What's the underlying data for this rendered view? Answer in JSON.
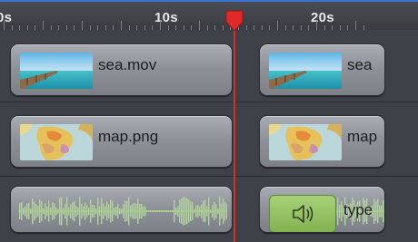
{
  "ruler": {
    "labels": [
      "0s",
      "10s",
      "20s"
    ]
  },
  "tracks": {
    "video": {
      "clip1_label": "sea.mov",
      "clip2_label": "sea"
    },
    "image": {
      "clip1_label": "map.png",
      "clip2_label": "map"
    },
    "audio": {
      "clip2_label": "type"
    }
  },
  "colors": {
    "accent": "#3b6fd0",
    "playhead": "#d92b2b",
    "clip": "#8f9299",
    "audio_badge": "#82b34f",
    "background": "#3f4148"
  },
  "icons": {
    "playhead": "playhead-marker-icon",
    "speaker": "speaker-icon"
  }
}
